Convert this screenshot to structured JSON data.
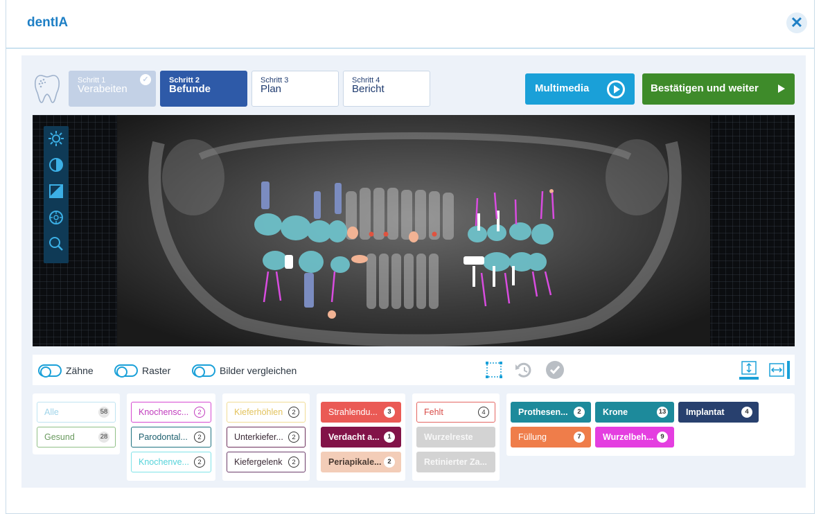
{
  "app": {
    "title": "dentIA",
    "close_label": "✕"
  },
  "steps": [
    {
      "num": "Schritt 1",
      "name": "Verabeiten",
      "state": "done"
    },
    {
      "num": "Schritt 2",
      "name": "Befunde",
      "state": "active"
    },
    {
      "num": "Schritt 3",
      "name": "Plan",
      "state": "pending"
    },
    {
      "num": "Schritt 4",
      "name": "Bericht",
      "state": "pending"
    }
  ],
  "actions": {
    "multimedia": "Multimedia",
    "confirm": "Bestätigen und weiter"
  },
  "viewer_tools": [
    "brightness-icon",
    "contrast-icon",
    "invert-icon",
    "target-icon",
    "zoom-icon"
  ],
  "toggles": {
    "teeth": "Zähne",
    "grid": "Raster",
    "compare": "Bilder vergleichen"
  },
  "filters": {
    "group1": [
      {
        "label": "Alle",
        "count": "58"
      },
      {
        "label": "Gesund",
        "count": "28"
      }
    ],
    "group2": [
      {
        "label": "Knochensc...",
        "count": "2"
      },
      {
        "label": "Parodontal...",
        "count": "2"
      },
      {
        "label": "Knochenve...",
        "count": "2"
      }
    ],
    "group3": [
      {
        "label": "Kieferhöhlen",
        "count": "2"
      },
      {
        "label": "Unterkiefer...",
        "count": "2"
      },
      {
        "label": "Kiefergelenk",
        "count": "2"
      }
    ],
    "group4": [
      {
        "label": "Strahlendu...",
        "count": "3"
      },
      {
        "label": "Verdacht a...",
        "count": "1"
      },
      {
        "label": "Periapikale...",
        "count": "2"
      }
    ],
    "group5": [
      {
        "label": "Fehlt",
        "count": "4"
      },
      {
        "label": "Wurzelreste",
        "count": ""
      },
      {
        "label": "Retinierter Za...",
        "count": ""
      }
    ],
    "group6": [
      {
        "label": "Prothesen...",
        "count": "2"
      },
      {
        "label": "Krone",
        "count": "13"
      },
      {
        "label": "Implantat",
        "count": "4"
      },
      {
        "label": "Füllung",
        "count": "7"
      },
      {
        "label": "Wurzelbeh...",
        "count": "9"
      }
    ]
  },
  "colors": {
    "brand": "#1e7fc5",
    "active_step": "#2e5aa8",
    "confirm": "#3e8b2a",
    "multimedia": "#1aa0d8"
  }
}
